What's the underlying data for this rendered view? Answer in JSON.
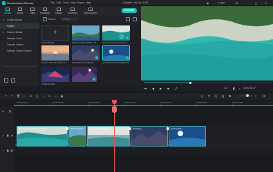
{
  "app": {
    "name": "Wondershare Filmora",
    "menus": [
      "File",
      "Edit",
      "Tools",
      "View",
      "Export",
      "Help"
    ],
    "project_title": "Untitled : 00:00:15:18",
    "login_label": "Login"
  },
  "toolbar": {
    "tabs": [
      {
        "label": "Media",
        "icon": "media-icon",
        "active": true
      },
      {
        "label": "Audio",
        "icon": "music-note-icon",
        "active": false
      },
      {
        "label": "Titles",
        "icon": "text-icon",
        "active": false
      },
      {
        "label": "Transition",
        "icon": "transition-icon",
        "active": false
      },
      {
        "label": "Effects",
        "icon": "effects-icon",
        "active": false
      },
      {
        "label": "Elements",
        "icon": "elements-icon",
        "active": false
      },
      {
        "label": "Split Screen",
        "icon": "split-screen-icon",
        "active": false
      }
    ],
    "export_label": "EXPORT"
  },
  "sidebar": {
    "items": [
      {
        "label": "Project Media",
        "selected": false,
        "caret": "▾"
      },
      {
        "label": "Folder",
        "selected": true,
        "caret": ""
      },
      {
        "label": "Shared Media",
        "selected": false,
        "caret": "▸"
      },
      {
        "label": "Sample Color",
        "selected": false,
        "caret": ""
      },
      {
        "label": "Sample Videos",
        "selected": false,
        "caret": ""
      },
      {
        "label": "Sample Green Screen",
        "selected": false,
        "caret": ""
      }
    ]
  },
  "media": {
    "search_placeholder": "Search",
    "record_label": "Record",
    "items": [
      {
        "label": "Import Media"
      },
      {
        "label": "Road in Island (2051) - Pr..."
      },
      {
        "label": "Sea waves & beach drone..."
      },
      {
        "label": "Sunrise with Sea View Ti..."
      },
      {
        "label": "landscape 4k wallpaper..."
      },
      {
        "label": "youtube kids 4k background..."
      },
      {
        "label": "Untitled Folder"
      }
    ]
  },
  "preview": {
    "timecode": "00:00:05:17",
    "ratio": "1/2",
    "progress": 0.37
  },
  "timeline": {
    "ruler_ticks": [
      "00:00:00:00",
      "00:00:04:00",
      "00:00:08:00",
      "00:00:12:00",
      "00:00:16:00",
      "00:00:20:00",
      "00:00:24:00",
      "00:00:28:00",
      "00:00:32:00"
    ],
    "clips": [
      {
        "label": "Sea waves & beach drone video..."
      },
      {
        "label": "Road in Island..."
      },
      {
        "label": "Sunrise with Sea View..."
      },
      {
        "label": "landscape..."
      },
      {
        "label": "youtube kids..."
      }
    ]
  }
}
